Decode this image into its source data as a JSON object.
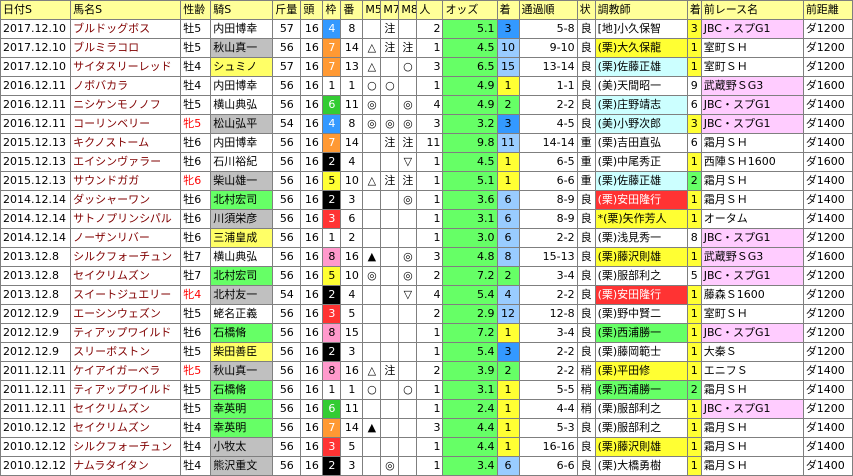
{
  "headers": [
    "日付S",
    "馬名S",
    "性齢",
    "騎S",
    "斤量",
    "頭",
    "枠",
    "番",
    "M5",
    "M7",
    "M8",
    "人",
    "オッズ",
    "着",
    "通過順",
    "状",
    "調教師",
    "着",
    "前レース名",
    "前距離"
  ],
  "rows": [
    {
      "date": "2017.12.10",
      "horse": "ブルドッグボス",
      "sex": "牡5",
      "jockey": "内田博幸",
      "jk": "",
      "wt": "57",
      "heads": "16",
      "frame": "4",
      "num": "8",
      "m5": "",
      "m7": "注",
      "m8": "",
      "pop": "2",
      "odds": "5.1",
      "rank": "3",
      "pass": "5-8",
      "cond": "良",
      "trainer": "[地]小久保智",
      "tr": "west",
      "prank": "3",
      "pr": "r1",
      "prace": "JBC・スプG1",
      "ptype": "pk",
      "pdist": "ダ1200"
    },
    {
      "date": "2017.12.10",
      "horse": "ブルミラコロ",
      "sex": "牡5",
      "jockey": "秋山真一",
      "jk": "gray",
      "wt": "56",
      "heads": "16",
      "frame": "7",
      "num": "14",
      "m5": "△",
      "m7": "注",
      "m8": "注",
      "pop": "1",
      "odds": "4.5",
      "rank": "10",
      "pass": "9-10",
      "cond": "良",
      "trainer": "(栗)大久保龍",
      "tr": "hly",
      "prank": "1",
      "pr": "r1",
      "prace": "室町ＳＨ",
      "ptype": "",
      "pdist": "ダ1200"
    },
    {
      "date": "2017.12.10",
      "horse": "サイタスリーレッド",
      "sex": "牡4",
      "jockey": "シュミノ",
      "jk": "yellow",
      "wt": "57",
      "heads": "16",
      "frame": "7",
      "num": "13",
      "m5": "△",
      "m7": "",
      "m8": "○",
      "pop": "3",
      "odds": "6.5",
      "rank": "15",
      "pass": "13-14",
      "cond": "良",
      "trainer": "(栗)佐藤正雄",
      "tr": "east",
      "prank": "1",
      "pr": "r1",
      "prace": "室町ＳＨ",
      "ptype": "",
      "pdist": "ダ1200"
    },
    {
      "date": "2016.12.11",
      "horse": "ノボバカラ",
      "sex": "牡4",
      "jockey": "内田博幸",
      "jk": "",
      "wt": "56",
      "heads": "16",
      "frame": "1",
      "num": "1",
      "m5": "○",
      "m7": "○",
      "m8": "",
      "pop": "1",
      "odds": "4.9",
      "rank": "1",
      "pass": "1-1",
      "cond": "良",
      "trainer": "(美)天間昭一",
      "tr": "west",
      "prank": "9",
      "pr": "",
      "prace": "武蔵野ＳG3",
      "ptype": "pk",
      "pdist": "ダ1600"
    },
    {
      "date": "2016.12.11",
      "horse": "ニシケンモノノフ",
      "sex": "牡5",
      "jockey": "横山典弘",
      "jk": "",
      "wt": "56",
      "heads": "16",
      "frame": "6",
      "num": "11",
      "m5": "◎",
      "m7": "",
      "m8": "◎",
      "pop": "4",
      "odds": "4.9",
      "rank": "2",
      "pass": "2-2",
      "cond": "良",
      "trainer": "(栗)庄野靖志",
      "tr": "east",
      "prank": "6",
      "pr": "",
      "prace": "JBC・スプG1",
      "ptype": "pk",
      "pdist": "ダ1400"
    },
    {
      "date": "2016.12.11",
      "horse": "コーリンベリー",
      "sex": "牝5",
      "jockey": "松山弘平",
      "jk": "gray",
      "wt": "54",
      "heads": "16",
      "frame": "4",
      "num": "8",
      "m5": "◎",
      "m7": "◎",
      "m8": "◎",
      "pop": "3",
      "odds": "3.2",
      "rank": "3",
      "pass": "4-5",
      "cond": "良",
      "trainer": "(美)小野次郎",
      "tr": "east",
      "prank": "3",
      "pr": "r1",
      "prace": "JBC・スプG1",
      "ptype": "pk",
      "pdist": "ダ1400"
    },
    {
      "date": "2015.12.13",
      "horse": "キクノストーム",
      "sex": "牡6",
      "jockey": "内田博幸",
      "jk": "",
      "wt": "56",
      "heads": "16",
      "frame": "7",
      "num": "14",
      "m5": "",
      "m7": "注",
      "m8": "注",
      "pop": "11",
      "odds": "9.8",
      "rank": "11",
      "pass": "14-14",
      "cond": "重",
      "trainer": "(栗)吉田直弘",
      "tr": "west",
      "prank": "6",
      "pr": "",
      "prace": "霜月ＳＨ",
      "ptype": "",
      "pdist": "ダ1400"
    },
    {
      "date": "2015.12.13",
      "horse": "エイシンヴァラー",
      "sex": "牡6",
      "jockey": "石川裕紀",
      "jk": "",
      "wt": "56",
      "heads": "16",
      "frame": "2",
      "num": "4",
      "m5": "",
      "m7": "",
      "m8": "▽",
      "pop": "1",
      "odds": "4.5",
      "rank": "1",
      "pass": "6-5",
      "cond": "重",
      "trainer": "(栗)中尾秀正",
      "tr": "west",
      "prank": "1",
      "pr": "r1",
      "prace": "西陣ＳＨ1600",
      "ptype": "",
      "pdist": "ダ1600"
    },
    {
      "date": "2015.12.13",
      "horse": "サウンドガガ",
      "sex": "牝6",
      "jockey": "柴山雄一",
      "jk": "gray",
      "wt": "56",
      "heads": "16",
      "frame": "5",
      "num": "10",
      "m5": "△",
      "m7": "注",
      "m8": "注",
      "pop": "1",
      "odds": "5.1",
      "rank": "1",
      "pass": "6-6",
      "cond": "重",
      "trainer": "(栗)佐藤正雄",
      "tr": "east",
      "prank": "2",
      "pr": "r2",
      "prace": "霜月ＳＨ",
      "ptype": "",
      "pdist": "ダ1400"
    },
    {
      "date": "2014.12.14",
      "horse": "ダッシャーワン",
      "sex": "牡6",
      "jockey": "北村宏司",
      "jk": "green",
      "wt": "56",
      "heads": "16",
      "frame": "2",
      "num": "3",
      "m5": "",
      "m7": "",
      "m8": "◎",
      "pop": "1",
      "odds": "3.6",
      "rank": "6",
      "pass": "8-9",
      "cond": "良",
      "trainer": "(栗)安田隆行",
      "tr": "hl",
      "prank": "1",
      "pr": "r1",
      "prace": "霜月ＳＨ",
      "ptype": "",
      "pdist": "ダ1400"
    },
    {
      "date": "2014.12.14",
      "horse": "サトノプリンシパル",
      "sex": "牡6",
      "jockey": "川須栄彦",
      "jk": "gray",
      "wt": "56",
      "heads": "16",
      "frame": "3",
      "num": "6",
      "m5": "",
      "m7": "",
      "m8": "",
      "pop": "1",
      "odds": "3.1",
      "rank": "6",
      "pass": "8-9",
      "cond": "良",
      "trainer": "*(栗)矢作芳人",
      "tr": "hly",
      "prank": "1",
      "pr": "r1",
      "prace": "オータム",
      "ptype": "",
      "pdist": "ダ1400"
    },
    {
      "date": "2014.12.14",
      "horse": "ノーザンリバー",
      "sex": "牡6",
      "jockey": "三浦皇成",
      "jk": "yellow",
      "wt": "56",
      "heads": "16",
      "frame": "1",
      "num": "2",
      "m5": "",
      "m7": "",
      "m8": "",
      "pop": "1",
      "odds": "3.0",
      "rank": "6",
      "pass": "2-2",
      "cond": "良",
      "trainer": "(栗)浅見秀一",
      "tr": "west",
      "prank": "8",
      "pr": "",
      "prace": "JBC・スプG1",
      "ptype": "pk",
      "pdist": "ダ1200"
    },
    {
      "date": "2013.12.8",
      "horse": "シルクフォーチュン",
      "sex": "牡7",
      "jockey": "横山典弘",
      "jk": "",
      "wt": "56",
      "heads": "16",
      "frame": "8",
      "num": "16",
      "m5": "▲",
      "m7": "",
      "m8": "◎",
      "pop": "3",
      "odds": "4.8",
      "rank": "8",
      "pass": "15-13",
      "cond": "良",
      "trainer": "(栗)藤沢則雄",
      "tr": "hly",
      "prank": "1",
      "pr": "r1",
      "prace": "武蔵野ＳG3",
      "ptype": "pk",
      "pdist": "ダ1600"
    },
    {
      "date": "2013.12.8",
      "horse": "セイクリムズン",
      "sex": "牡7",
      "jockey": "北村宏司",
      "jk": "green",
      "wt": "56",
      "heads": "16",
      "frame": "5",
      "num": "10",
      "m5": "◎",
      "m7": "",
      "m8": "◎",
      "pop": "2",
      "odds": "7.2",
      "rank": "2",
      "pass": "3-4",
      "cond": "良",
      "trainer": "(栗)服部利之",
      "tr": "west",
      "prank": "5",
      "pr": "",
      "prace": "JBC・スプG1",
      "ptype": "pk",
      "pdist": "ダ1200"
    },
    {
      "date": "2013.12.8",
      "horse": "スイートジュエリー",
      "sex": "牝4",
      "jockey": "北村友一",
      "jk": "gray",
      "wt": "54",
      "heads": "16",
      "frame": "2",
      "num": "4",
      "m5": "",
      "m7": "",
      "m8": "▽",
      "pop": "4",
      "odds": "5.4",
      "rank": "4",
      "pass": "2-2",
      "cond": "良",
      "trainer": "(栗)安田隆行",
      "tr": "hl",
      "prank": "1",
      "pr": "r1",
      "prace": "藤森Ｓ1600",
      "ptype": "",
      "pdist": "ダ1200"
    },
    {
      "date": "2012.12.9",
      "horse": "エーシンウェズン",
      "sex": "牡5",
      "jockey": "蛯名正義",
      "jk": "",
      "wt": "56",
      "heads": "16",
      "frame": "3",
      "num": "5",
      "m5": "",
      "m7": "",
      "m8": "",
      "pop": "2",
      "odds": "2.9",
      "rank": "12",
      "pass": "12-8",
      "cond": "良",
      "trainer": "(栗)野中賢二",
      "tr": "west",
      "prank": "1",
      "pr": "r1",
      "prace": "室町ＳＨ",
      "ptype": "",
      "pdist": "ダ1200"
    },
    {
      "date": "2012.12.9",
      "horse": "ティアップワイルド",
      "sex": "牡6",
      "jockey": "石橋脩",
      "jk": "green",
      "wt": "56",
      "heads": "16",
      "frame": "8",
      "num": "15",
      "m5": "",
      "m7": "",
      "m8": "",
      "pop": "1",
      "odds": "7.2",
      "rank": "1",
      "pass": "3-4",
      "cond": "良",
      "trainer": "(栗)西浦勝一",
      "tr": "hlg",
      "prank": "1",
      "pr": "r1",
      "prace": "JBC・スプG1",
      "ptype": "pk",
      "pdist": "ダ1200"
    },
    {
      "date": "2012.12.9",
      "horse": "スリーボストン",
      "sex": "牡5",
      "jockey": "柴田善臣",
      "jk": "yellow",
      "wt": "56",
      "heads": "16",
      "frame": "2",
      "num": "3",
      "m5": "",
      "m7": "",
      "m8": "",
      "pop": "1",
      "odds": "5.4",
      "rank": "3",
      "pass": "2-2",
      "cond": "良",
      "trainer": "(栗)藤岡範士",
      "tr": "west",
      "prank": "1",
      "pr": "r1",
      "prace": "大秦Ｓ",
      "ptype": "",
      "pdist": "ダ1200"
    },
    {
      "date": "2011.12.11",
      "horse": "ケイアイガーベラ",
      "sex": "牝5",
      "jockey": "秋山真一",
      "jk": "gray",
      "wt": "56",
      "heads": "16",
      "frame": "8",
      "num": "16",
      "m5": "△",
      "m7": "注",
      "m8": "",
      "pop": "2",
      "odds": "3.9",
      "rank": "2",
      "pass": "2-2",
      "cond": "稍",
      "trainer": "(栗)平田修",
      "tr": "hly",
      "prank": "1",
      "pr": "r1",
      "prace": "エニフＳ",
      "ptype": "",
      "pdist": "ダ1400"
    },
    {
      "date": "2011.12.11",
      "horse": "ティアップワイルド",
      "sex": "牡5",
      "jockey": "石橋脩",
      "jk": "green",
      "wt": "56",
      "heads": "16",
      "frame": "1",
      "num": "1",
      "m5": "○",
      "m7": "",
      "m8": "○",
      "pop": "1",
      "odds": "3.1",
      "rank": "1",
      "pass": "5-5",
      "cond": "稍",
      "trainer": "(栗)西浦勝一",
      "tr": "hlg",
      "prank": "2",
      "pr": "r2",
      "prace": "霜月ＳＨ",
      "ptype": "",
      "pdist": "ダ1400"
    },
    {
      "date": "2011.12.11",
      "horse": "セイクリムズン",
      "sex": "牡5",
      "jockey": "幸英明",
      "jk": "green",
      "wt": "56",
      "heads": "16",
      "frame": "6",
      "num": "11",
      "m5": "",
      "m7": "",
      "m8": "",
      "pop": "1",
      "odds": "2.4",
      "rank": "1",
      "pass": "4-4",
      "cond": "稍",
      "trainer": "(栗)服部利之",
      "tr": "west",
      "prank": "1",
      "pr": "r1",
      "prace": "JBC・スプG1",
      "ptype": "pk",
      "pdist": "ダ1200"
    },
    {
      "date": "2010.12.12",
      "horse": "セイクリムズン",
      "sex": "牡4",
      "jockey": "幸英明",
      "jk": "green",
      "wt": "56",
      "heads": "16",
      "frame": "7",
      "num": "14",
      "m5": "▲",
      "m7": "",
      "m8": "",
      "pop": "3",
      "odds": "4.4",
      "rank": "1",
      "pass": "5-3",
      "cond": "良",
      "trainer": "(栗)服部利之",
      "tr": "west",
      "prank": "1",
      "pr": "r1",
      "prace": "霜月ＳＨ",
      "ptype": "",
      "pdist": "ダ1400"
    },
    {
      "date": "2010.12.12",
      "horse": "シルクフォーチュン",
      "sex": "牡4",
      "jockey": "小牧太",
      "jk": "gray",
      "wt": "56",
      "heads": "16",
      "frame": "3",
      "num": "5",
      "m5": "",
      "m7": "",
      "m8": "",
      "pop": "1",
      "odds": "4.4",
      "rank": "1",
      "pass": "16-16",
      "cond": "良",
      "trainer": "(栗)藤沢則雄",
      "tr": "hly",
      "prank": "1",
      "pr": "r1",
      "prace": "霜月ＳＨ",
      "ptype": "",
      "pdist": "ダ1400"
    },
    {
      "date": "2010.12.12",
      "horse": "ナムラタイタン",
      "sex": "牡4",
      "jockey": "熊沢重文",
      "jk": "gray",
      "wt": "56",
      "heads": "16",
      "frame": "2",
      "num": "3",
      "m5": "",
      "m7": "◎",
      "m8": "",
      "pop": "1",
      "odds": "3.4",
      "rank": "6",
      "pass": "6-6",
      "cond": "良",
      "trainer": "(栗)大橋勇樹",
      "tr": "west",
      "prank": "1",
      "pr": "r1",
      "prace": "霜月ＳＨ",
      "ptype": "",
      "pdist": "ダ1400"
    }
  ]
}
